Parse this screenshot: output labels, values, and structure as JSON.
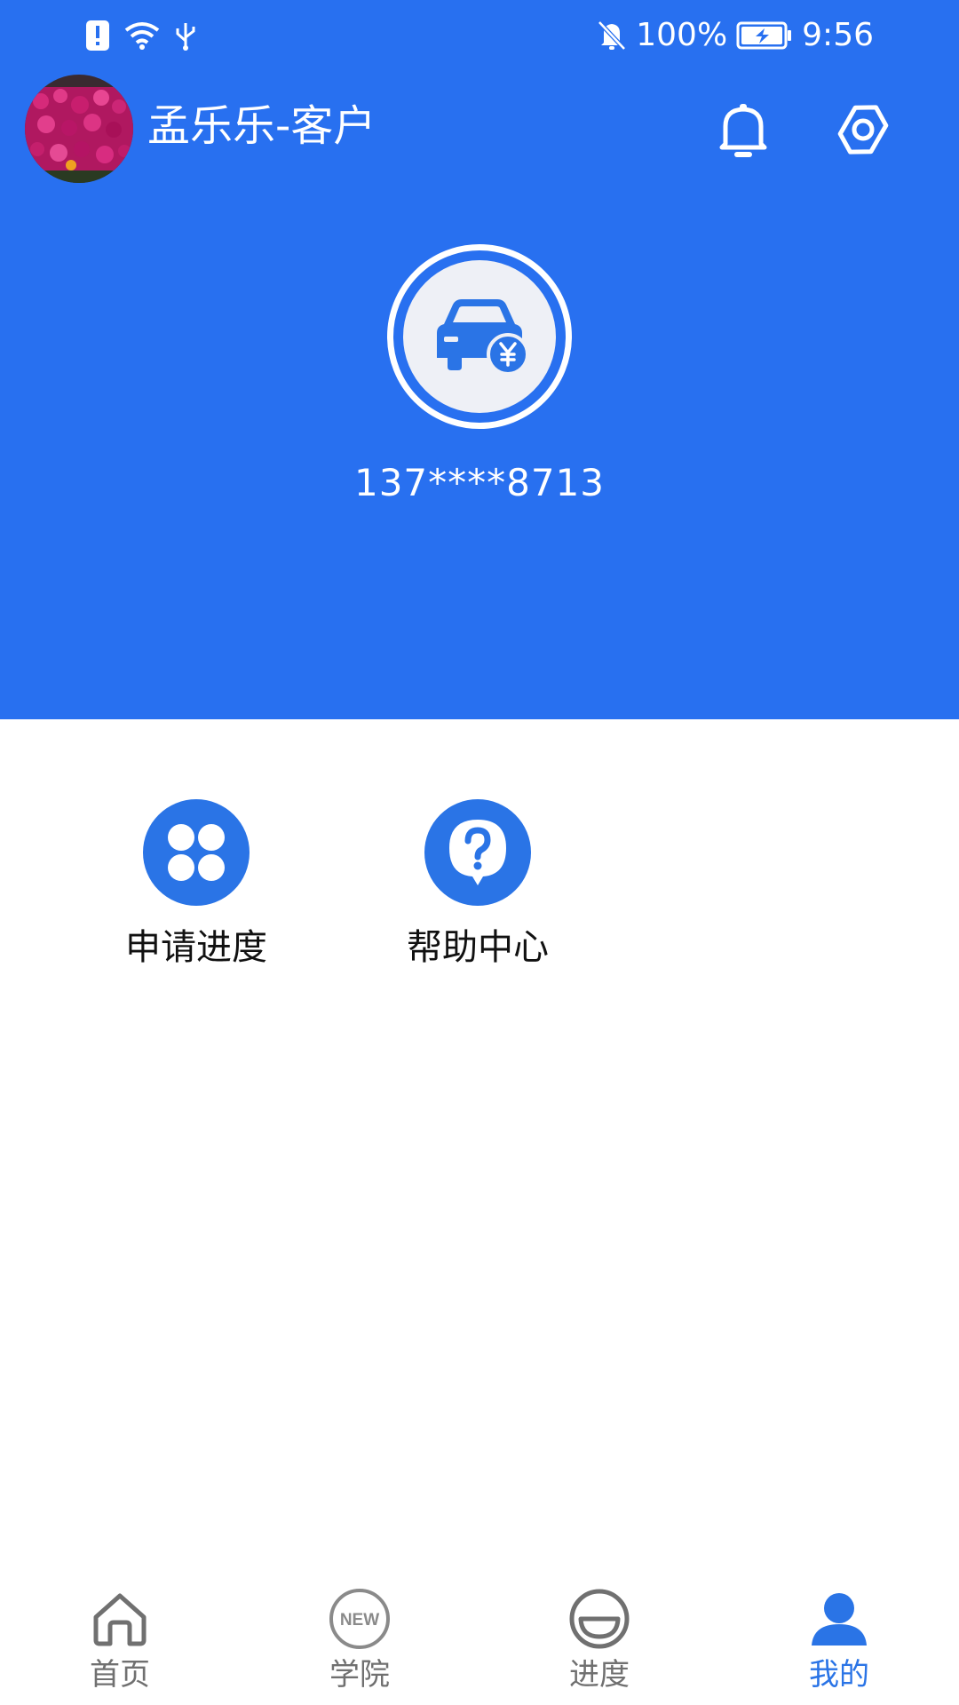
{
  "status_bar": {
    "battery": "100%",
    "time": "9:56",
    "icons": [
      "alert-icon",
      "wifi-icon",
      "usb-icon",
      "bell-muted-icon",
      "battery-charging-icon"
    ]
  },
  "user": {
    "name": "孟乐乐-客户",
    "phone": "137****8713"
  },
  "header": {
    "background": "#2870f0",
    "icons": [
      "bell-icon",
      "gear-icon",
      "car-loan-icon"
    ]
  },
  "actions": [
    {
      "label": "申请进度",
      "icon": "clover-icon"
    },
    {
      "label": "帮助中心",
      "icon": "help-bubble-icon"
    }
  ],
  "bottom_nav": {
    "items": [
      {
        "label": "首页",
        "icon": "home-icon",
        "active": false
      },
      {
        "label": "学院",
        "icon": "new-badge-icon",
        "badge_text": "NEW",
        "active": false
      },
      {
        "label": "进度",
        "icon": "progress-icon",
        "active": false
      },
      {
        "label": "我的",
        "icon": "person-icon",
        "active": true
      }
    ],
    "active_color": "#2a74e6",
    "inactive_color": "#707070"
  }
}
